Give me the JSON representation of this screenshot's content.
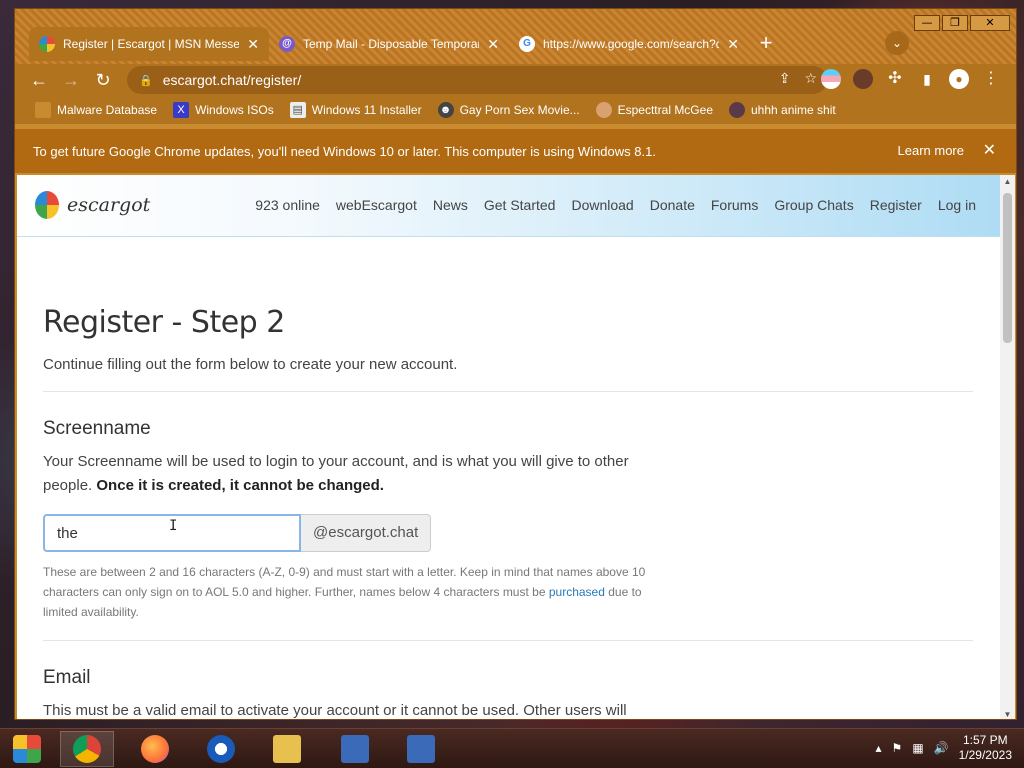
{
  "window": {
    "controls": {
      "minimize": "—",
      "maximize": "❐",
      "close": "✕"
    }
  },
  "tabs": [
    {
      "title": "Register | Escargot | MSN Messe",
      "favicon": "escargot-icon",
      "close": "✕",
      "active": true
    },
    {
      "title": "Temp Mail - Disposable Temporar",
      "favicon": "tempmail-icon",
      "close": "✕",
      "active": false
    },
    {
      "title": "https://www.google.com/search?q",
      "favicon": "google-icon",
      "close": "✕",
      "active": false
    }
  ],
  "toolbar": {
    "back": "←",
    "forward": "→",
    "reload": "↻",
    "url": "escargot.chat/register/",
    "lock": "🔒",
    "share": "⇪",
    "star": "☆"
  },
  "bookmarks": [
    {
      "label": "Malware Database",
      "icon": "folder-icon"
    },
    {
      "label": "Windows ISOs",
      "icon": "x-icon"
    },
    {
      "label": "Windows 11 Installer",
      "icon": "page-icon"
    },
    {
      "label": "Gay Porn Sex Movie...",
      "icon": "site-icon"
    },
    {
      "label": "Especttral McGee",
      "icon": "avatar-icon"
    },
    {
      "label": "uhhh anime shit",
      "icon": "anime-icon"
    }
  ],
  "infobar": {
    "message": "To get future Google Chrome updates, you'll need Windows 10 or later. This computer is using Windows 8.1.",
    "learn_more": "Learn more",
    "close": "✕"
  },
  "site": {
    "logo_text": "escargot",
    "nav": [
      "923 online",
      "webEscargot",
      "News",
      "Get Started",
      "Download",
      "Donate",
      "Forums",
      "Group Chats",
      "Register",
      "Log in"
    ]
  },
  "page": {
    "title": "Register - Step 2",
    "lead": "Continue filling out the form below to create your new account.",
    "screenname": {
      "heading": "Screenname",
      "desc": "Your Screenname will be used to login to your account, and is what you will give to other people.",
      "desc_bold": "Once it is created, it cannot be changed.",
      "value": "the",
      "suffix": "@escargot.chat",
      "help_1": "These are between 2 and 16 characters (A-Z, 0-9) and must start with a letter. Keep in mind that names above 10 characters can only sign on to AOL 5.0 and higher. Further, names below 4 characters must be",
      "help_link": "purchased",
      "help_2": "due to limited availability."
    },
    "email": {
      "heading": "Email",
      "desc": "This must be a valid email to activate your account or it cannot be used. Other users will"
    }
  },
  "taskbar": {
    "apps": [
      "start-icon",
      "chrome-icon",
      "firefox-icon",
      "obama-icon",
      "file-explorer-icon",
      "network-icon",
      "network-icon"
    ],
    "time": "1:57 PM",
    "date": "1/29/2023"
  }
}
